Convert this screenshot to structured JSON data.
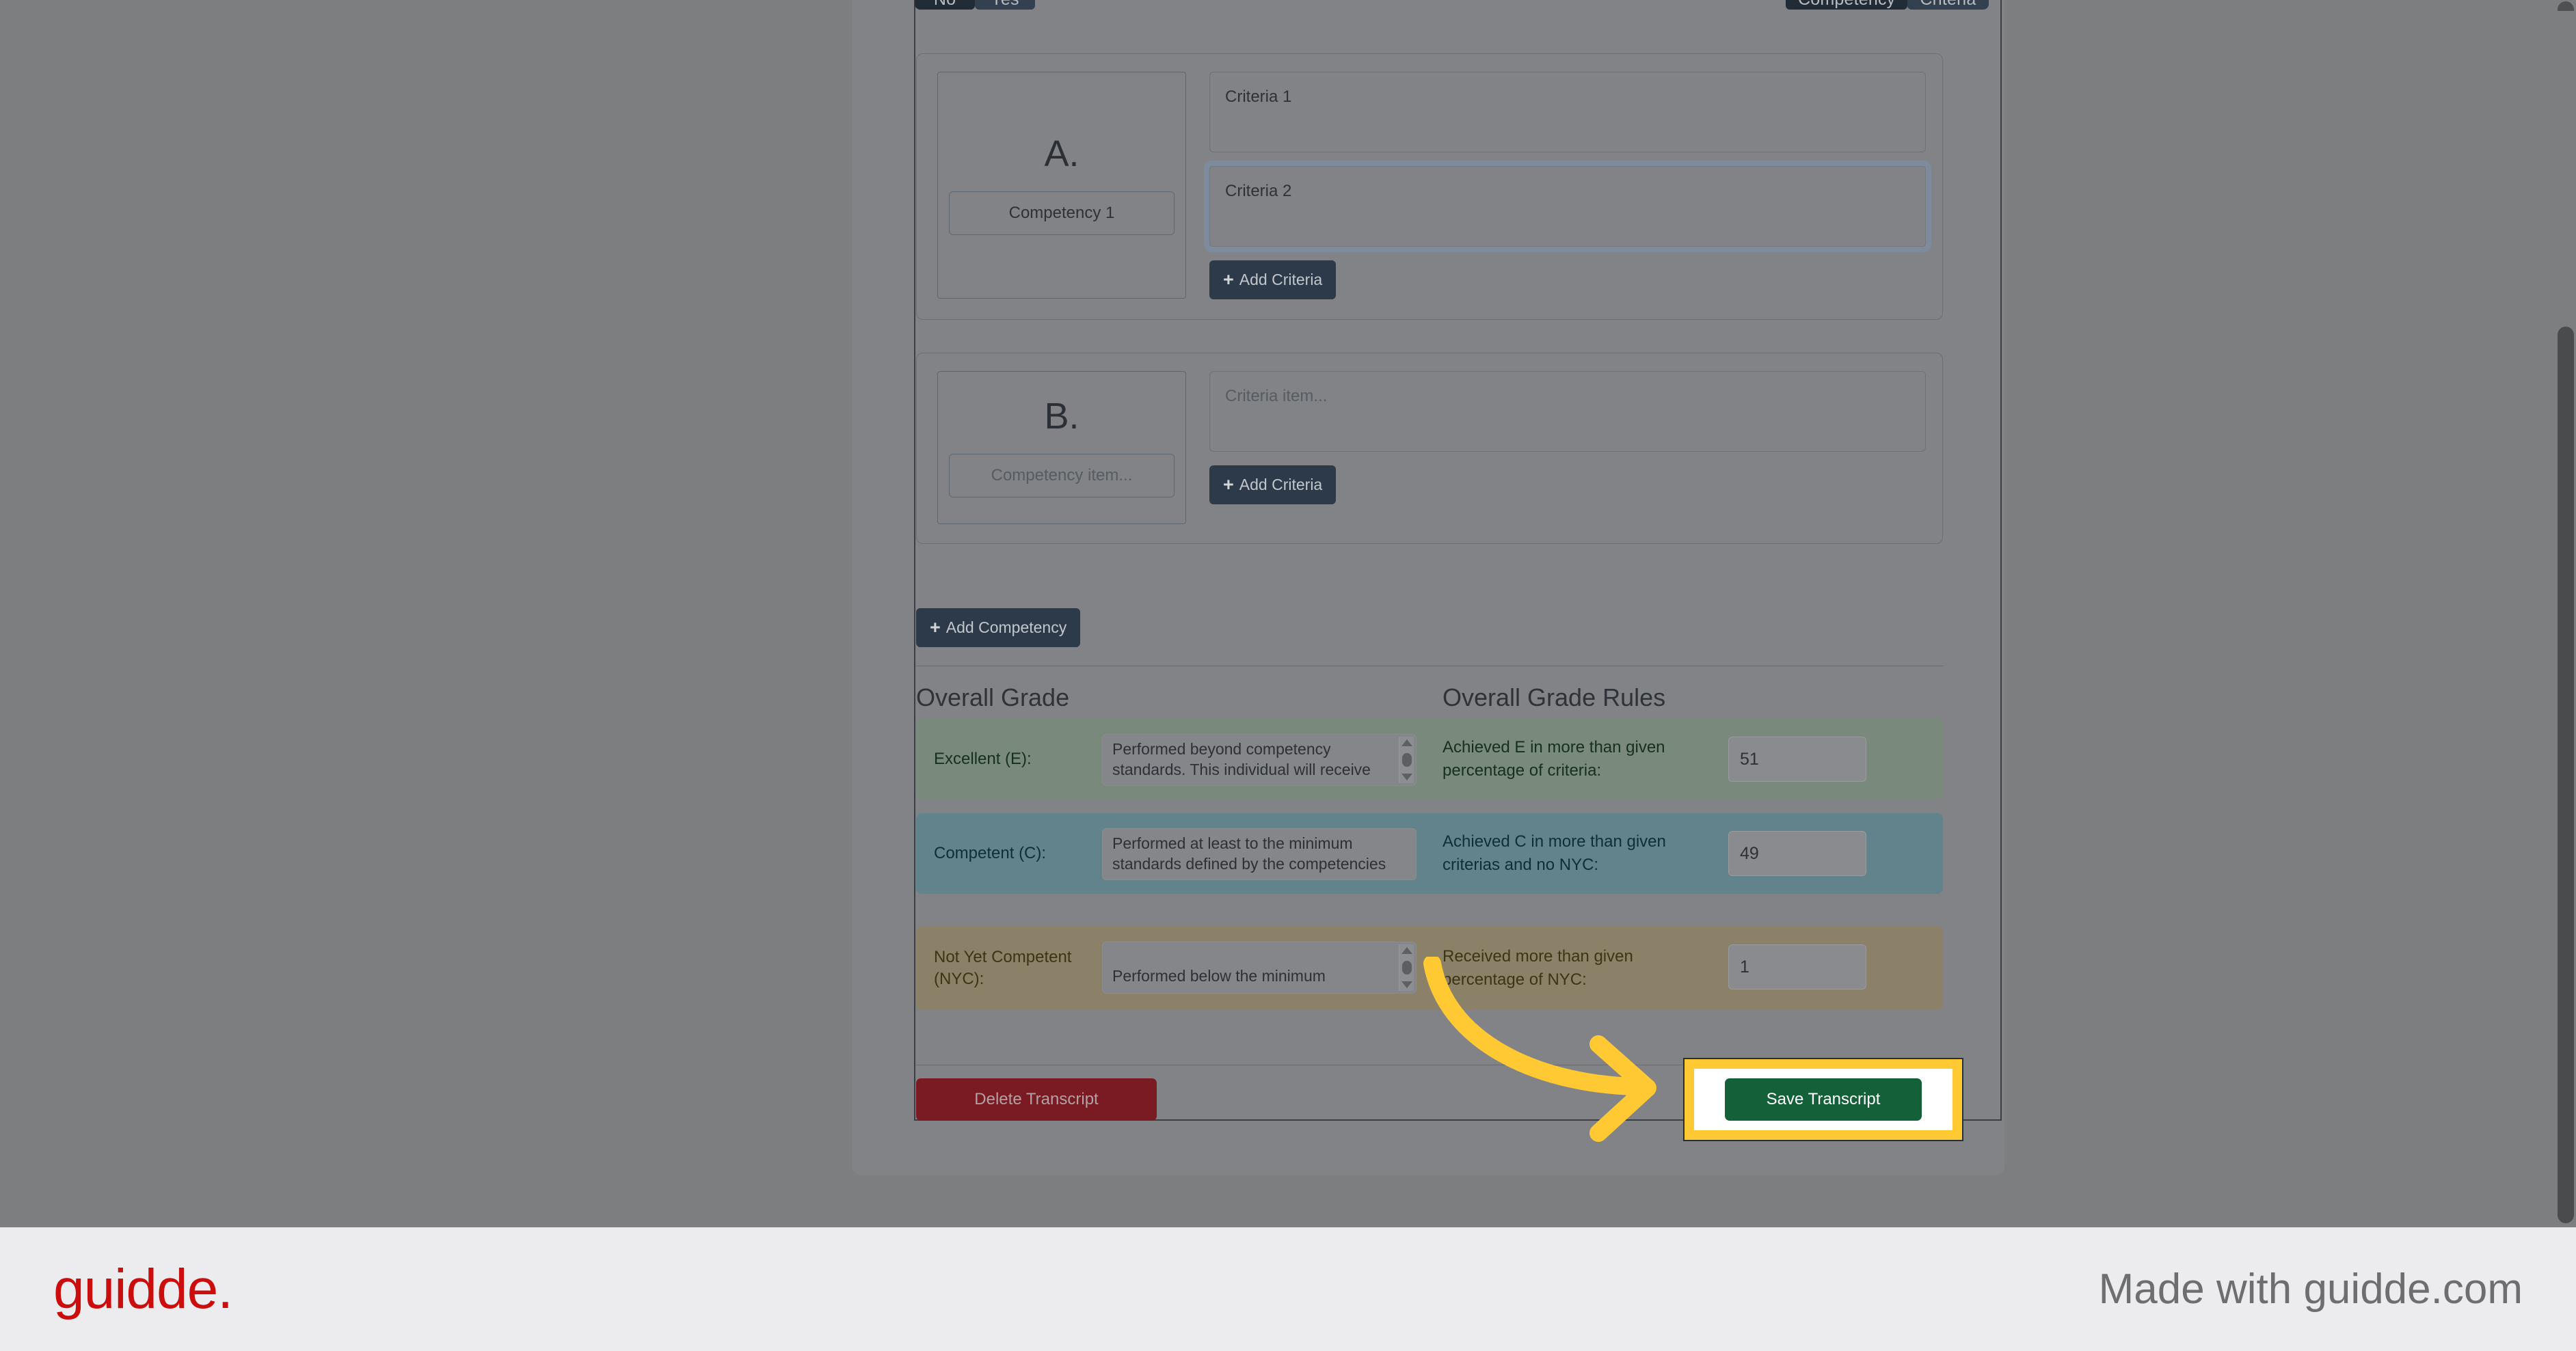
{
  "toggles": {
    "left_group": [
      {
        "label": "No",
        "active": true
      },
      {
        "label": "Yes",
        "active": false
      }
    ],
    "right_group": [
      {
        "label": "Competency",
        "active": true
      },
      {
        "label": "Criteria",
        "active": false
      }
    ]
  },
  "competencies": [
    {
      "letter": "A.",
      "name_value": "Competency 1",
      "name_is_placeholder": false,
      "criteria": [
        {
          "value": "Criteria 1",
          "is_placeholder": false,
          "focused": false
        },
        {
          "value": "Criteria 2",
          "is_placeholder": false,
          "focused": true
        }
      ],
      "add_criteria_label": "Add Criteria"
    },
    {
      "letter": "B.",
      "name_value": "Competency item...",
      "name_is_placeholder": true,
      "criteria": [
        {
          "value": "Criteria item...",
          "is_placeholder": true,
          "focused": false
        }
      ],
      "add_criteria_label": "Add Criteria"
    }
  ],
  "add_competency_label": "Add Competency",
  "grade_section": {
    "heading_left": "Overall Grade",
    "heading_right": "Overall Grade Rules",
    "rows": [
      {
        "label": "Excellent (E):",
        "description": "Performed beyond competency standards. This individual will receive",
        "rule_text": "Achieved E in more than given percentage of criteria:",
        "rule_value": "51",
        "bg_color": "#79897c"
      },
      {
        "label": "Competent (C):",
        "description": "Performed at least to the minimum standards defined by the competencies",
        "rule_text": "Achieved C in more than given criterias and no NYC:",
        "rule_value": "49",
        "bg_color": "#63838c"
      },
      {
        "label": "Not Yet Competent (NYC):",
        "description": "Performed below the minimum",
        "rule_text": "Received more than given percentage of NYC:",
        "rule_value": "1",
        "bg_color": "#8a8168"
      }
    ]
  },
  "actions": {
    "delete_label": "Delete Transcript",
    "save_label": "Save Transcript",
    "highlight_color": "#ffc933",
    "save_color": "#146139",
    "delete_color": "#7a1b24"
  },
  "footer": {
    "logo": "guidde.",
    "made_with": "Made with guidde.com",
    "logo_color": "#cc0d0d"
  }
}
